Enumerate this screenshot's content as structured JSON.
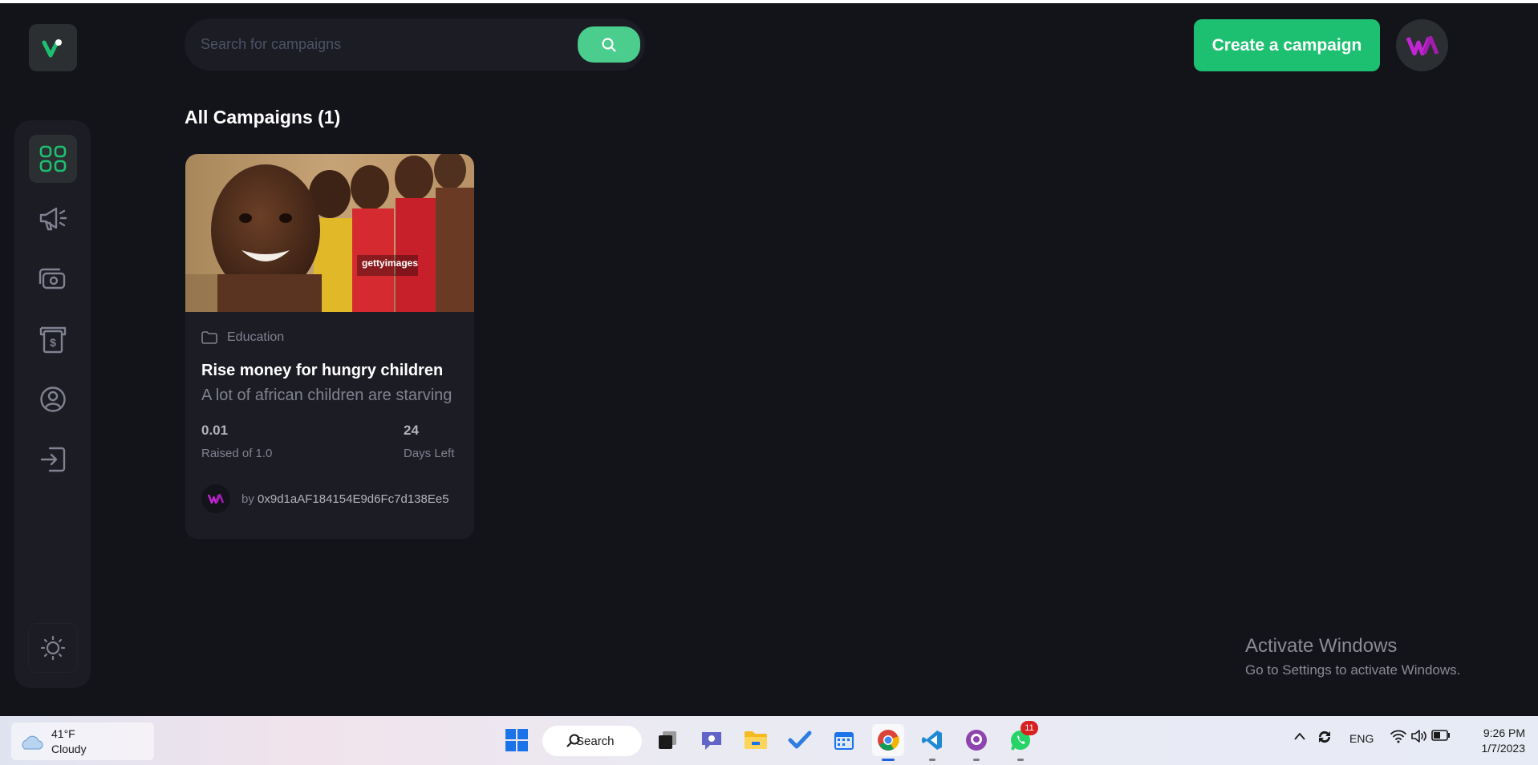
{
  "search": {
    "placeholder": "Search for campaigns"
  },
  "header": {
    "create_label": "Create a campaign"
  },
  "main": {
    "heading": "All Campaigns (1)"
  },
  "campaigns": [
    {
      "category": "Education",
      "title": "Rise money for hungry children",
      "description": "A lot of african children are starving",
      "raised": "0.01",
      "raised_label": "Raised of 1.0",
      "days": "24",
      "days_label": "Days Left",
      "owner_prefix": "by ",
      "owner": "0x9d1aAF184154E9d6Fc7d138Ee5",
      "image_watermark": "gettyimages"
    }
  ],
  "sidebar": {
    "items": [
      {
        "icon": "dashboard-icon",
        "active": true
      },
      {
        "icon": "megaphone-icon",
        "active": false
      },
      {
        "icon": "payment-icon",
        "active": false
      },
      {
        "icon": "withdraw-icon",
        "active": false
      },
      {
        "icon": "profile-icon",
        "active": false
      },
      {
        "icon": "logout-icon",
        "active": false
      }
    ],
    "theme_icon": "sun-icon"
  },
  "watermark": {
    "line1": "Activate Windows",
    "line2": "Go to Settings to activate Windows."
  },
  "taskbar": {
    "weather_temp": "41°F",
    "weather_desc": "Cloudy",
    "search_label": "Search",
    "whatsapp_badge": "11",
    "language": "ENG",
    "time": "9:26 PM",
    "date": "1/7/2023"
  },
  "colors": {
    "background": "#13131a",
    "panel": "#1c1c24",
    "accent": "#1dc071",
    "accent_light": "#4acd8d",
    "brand_magenta": "#c026d3"
  }
}
